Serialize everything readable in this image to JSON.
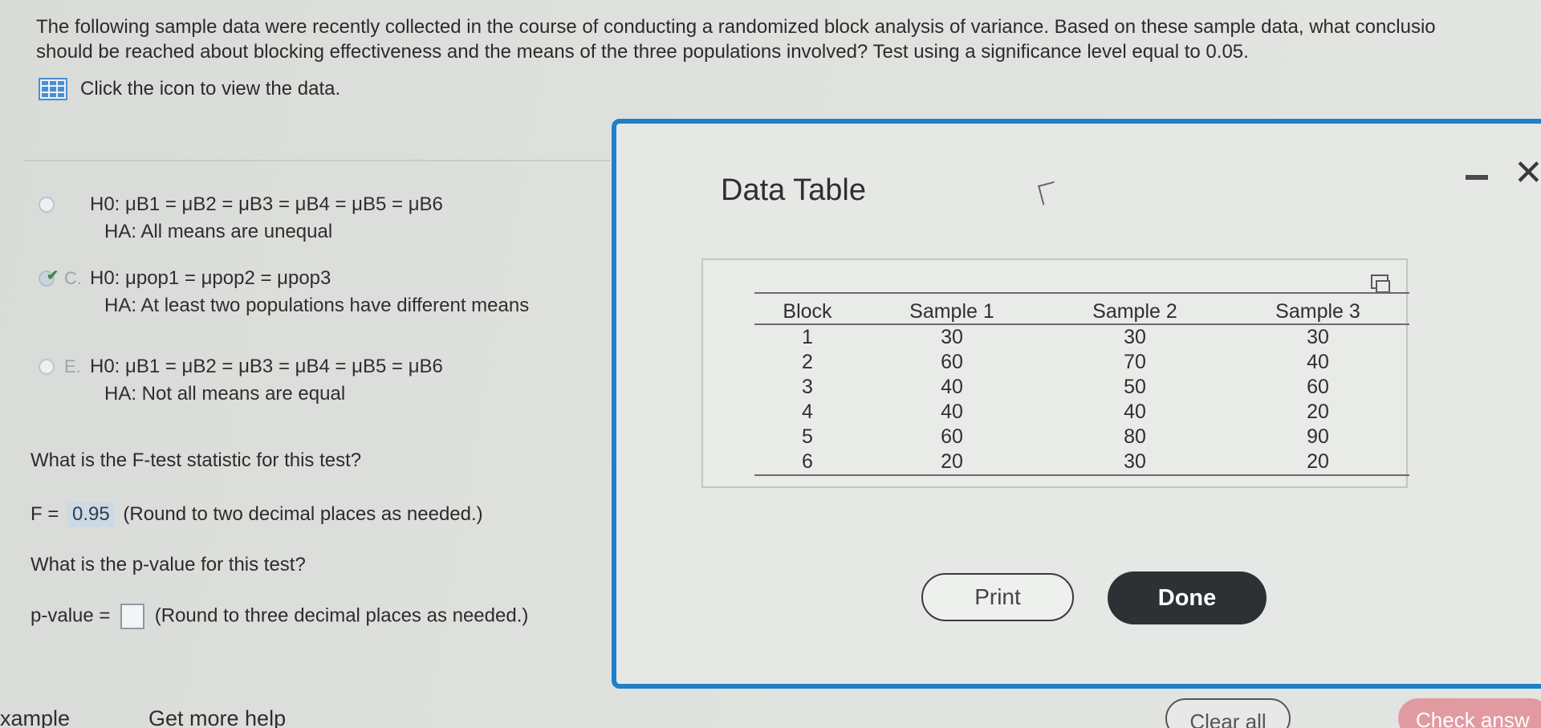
{
  "question": {
    "line1": "The following sample data were recently collected in the course of conducting a randomized block analysis of variance. Based on these sample data, what conclusio",
    "line2": "should be reached about blocking effectiveness and the means of the three populations involved? Test using a significance level equal to 0.05."
  },
  "data_link": {
    "label": "Click the icon to view the data."
  },
  "options": [
    {
      "letter": "",
      "h0": "H0: μB1 = μB2 = μB3 = μB4 = μB5 = μB6",
      "ha": "HA: All means are unequal",
      "selected": false
    },
    {
      "letter": "C.",
      "h0": "H0: μpop1 = μpop2 = μpop3",
      "ha": "HA: At least two populations have different means",
      "selected": true
    },
    {
      "letter": "E.",
      "h0": "H0: μB1 = μB2 = μB3 = μB4 = μB5 = μB6",
      "ha": "HA: Not all means are equal",
      "selected": false
    }
  ],
  "f_question": "What is the F-test statistic for this test?",
  "f_answer": {
    "prefix": "F =",
    "value": "0.95",
    "hint": "(Round to two decimal places as needed.)"
  },
  "p_question": "What is the p-value for this test?",
  "p_answer": {
    "prefix": "p-value =",
    "value": "",
    "hint": "(Round to three decimal places as needed.)"
  },
  "modal": {
    "title": "Data Table",
    "table": {
      "headers": [
        "Block",
        "Sample 1",
        "Sample 2",
        "Sample 3"
      ],
      "rows": [
        [
          "1",
          "30",
          "30",
          "30"
        ],
        [
          "2",
          "60",
          "70",
          "40"
        ],
        [
          "3",
          "40",
          "50",
          "60"
        ],
        [
          "4",
          "40",
          "40",
          "20"
        ],
        [
          "5",
          "60",
          "80",
          "90"
        ],
        [
          "6",
          "20",
          "30",
          "20"
        ]
      ]
    },
    "print_label": "Print",
    "done_label": "Done"
  },
  "footer": {
    "example_label": "xample",
    "help_label": "Get more help",
    "clear_label": "Clear all",
    "check_label": "Check answ"
  },
  "colors": {
    "modal_border": "#1f80c8",
    "done_bg": "#2d3134",
    "answer_bg": "#cdd9e4",
    "check_bg": "#e29aa1"
  }
}
